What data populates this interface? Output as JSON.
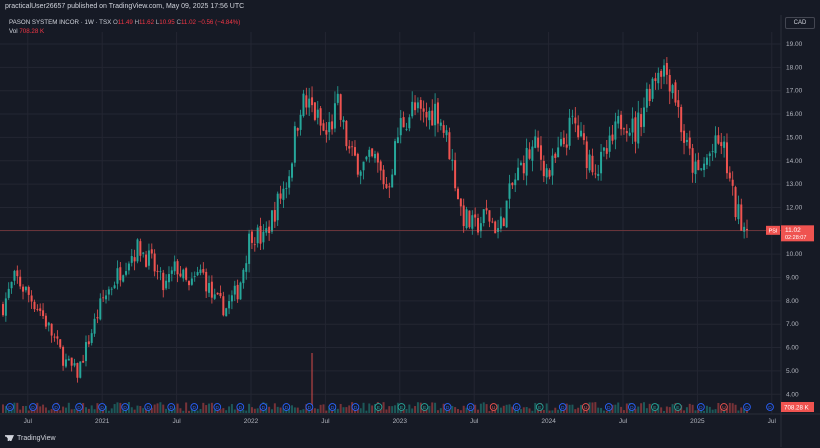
{
  "header": {
    "publisher_text": "practicalUser26657 published on TradingView.com, May 09, 2025 17:56 UTC"
  },
  "legend": {
    "title": "PASON SYSTEM INCOR · 1W · TSX",
    "o_label": "O",
    "o_value": "11.49",
    "h_label": "H",
    "h_value": "11.62",
    "l_label": "L",
    "l_value": "10.95",
    "c_label": "C",
    "c_value": "11.02",
    "change": "−0.56 (−4.84%)",
    "vol_label": "Vol",
    "vol_value": "708.28 K"
  },
  "currency": "CAD",
  "price_tag": {
    "symbol": "PSI",
    "price": "11.02",
    "countdown": "02:28:07"
  },
  "vol_tag": "708.28 K",
  "footer": {
    "brand": "TradingView"
  },
  "colors": {
    "up": "#26a69a",
    "down": "#ef5350",
    "background": "#161a25",
    "grid": "#232632"
  },
  "icons": [
    "tradingview-logo-icon"
  ],
  "chart_data": {
    "type": "candlestick",
    "symbol": "PSI",
    "interval": "1W",
    "y_ticks": [
      "19.00",
      "18.00",
      "17.00",
      "16.00",
      "15.00",
      "14.00",
      "13.00",
      "12.00",
      "11.00",
      "10.00",
      "9.00",
      "8.00",
      "7.00",
      "6.00",
      "5.00",
      "4.00"
    ],
    "ylim": [
      3.95,
      19.6
    ],
    "x_ticks": [
      "Jul",
      "2021",
      "Jul",
      "2022",
      "Jul",
      "2023",
      "Jul",
      "2024",
      "Jul",
      "2025",
      "Jul"
    ],
    "price_path": [
      [
        "2020-05",
        7.8
      ],
      [
        "2020-06",
        9.0
      ],
      [
        "2020-08",
        7.6
      ],
      [
        "2020-10",
        5.4
      ],
      [
        "2020-11",
        4.9
      ],
      [
        "2021-01",
        8.0
      ],
      [
        "2021-03",
        9.8
      ],
      [
        "2021-04",
        10.3
      ],
      [
        "2021-05",
        9.6
      ],
      [
        "2021-06",
        8.5
      ],
      [
        "2021-07",
        9.5
      ],
      [
        "2021-08",
        8.5
      ],
      [
        "2021-09",
        9.3
      ],
      [
        "2021-10",
        8.0
      ],
      [
        "2021-11",
        7.7
      ],
      [
        "2021-12",
        8.5
      ],
      [
        "2022-01",
        11.0
      ],
      [
        "2022-02",
        10.6
      ],
      [
        "2022-03",
        12.0
      ],
      [
        "2022-04",
        13.3
      ],
      [
        "2022-05",
        16.5
      ],
      [
        "2022-06",
        16.2
      ],
      [
        "2022-07",
        15.0
      ],
      [
        "2022-08",
        16.3
      ],
      [
        "2022-09",
        14.2
      ],
      [
        "2022-10",
        13.8
      ],
      [
        "2022-11",
        14.0
      ],
      [
        "2022-12",
        12.8
      ],
      [
        "2023-01",
        15.5
      ],
      [
        "2023-02",
        16.2
      ],
      [
        "2023-03",
        15.8
      ],
      [
        "2023-04",
        16.3
      ],
      [
        "2023-05",
        14.5
      ],
      [
        "2023-06",
        11.7
      ],
      [
        "2023-07",
        11.1
      ],
      [
        "2023-08",
        11.7
      ],
      [
        "2023-09",
        11.0
      ],
      [
        "2023-10",
        12.8
      ],
      [
        "2023-11",
        14.0
      ],
      [
        "2023-12",
        14.6
      ],
      [
        "2024-01",
        13.4
      ],
      [
        "2024-02",
        14.5
      ],
      [
        "2024-03",
        15.7
      ],
      [
        "2024-04",
        14.3
      ],
      [
        "2024-05",
        13.7
      ],
      [
        "2024-06",
        14.6
      ],
      [
        "2024-07",
        16.0
      ],
      [
        "2024-08",
        15.2
      ],
      [
        "2024-09",
        17.0
      ],
      [
        "2024-10",
        18.2
      ],
      [
        "2024-11",
        17.4
      ],
      [
        "2024-12",
        14.7
      ],
      [
        "2025-01",
        13.3
      ],
      [
        "2025-02",
        14.3
      ],
      [
        "2025-03",
        14.8
      ],
      [
        "2025-04",
        12.0
      ],
      [
        "2025-05",
        11.02
      ]
    ],
    "volume_spike": [
      "2022-06",
      6.0
    ],
    "last_price": 11.02,
    "earnings_markers": [
      "D",
      "D",
      "D",
      "D",
      "D",
      "D",
      "D",
      "D",
      "D",
      "D",
      "D",
      "D",
      "D",
      "D",
      "D",
      "D",
      "E",
      "E",
      "E",
      "D",
      "D",
      "U",
      "D",
      "E",
      "D",
      "U",
      "D",
      "D",
      "E",
      "E",
      "D",
      "U",
      "D",
      "D"
    ]
  }
}
